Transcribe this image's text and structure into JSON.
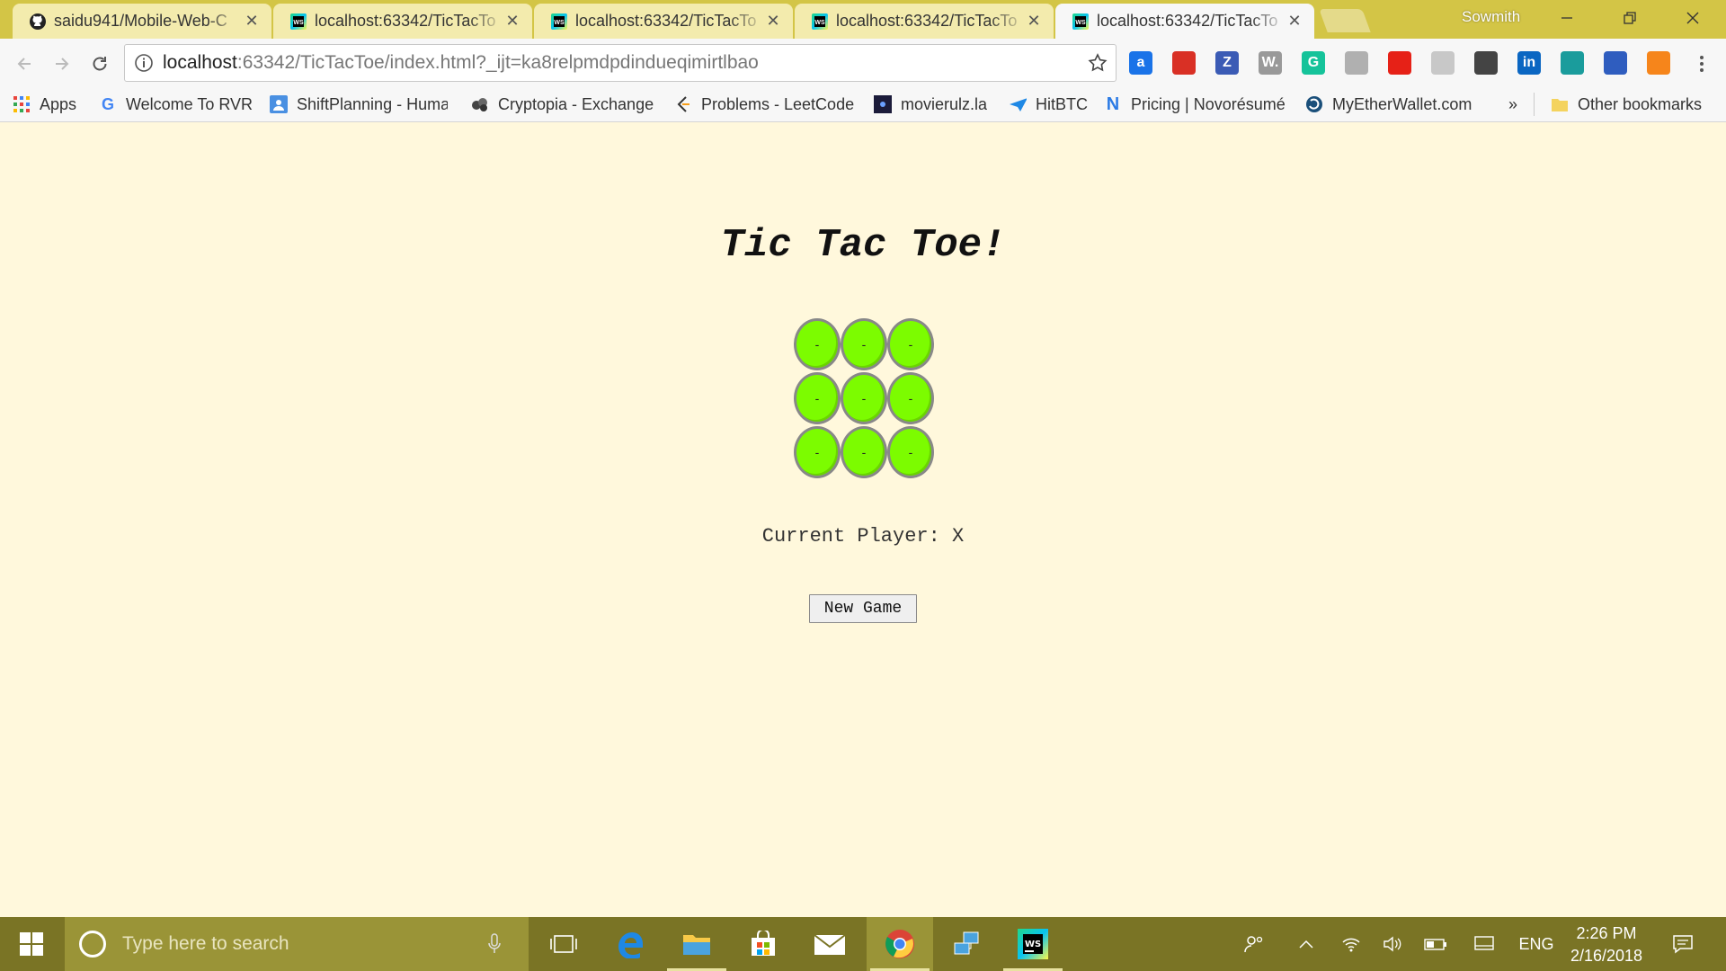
{
  "browser": {
    "tabs": [
      {
        "title": "saidu941/Mobile-Web-C",
        "icon": "github-icon",
        "active": false
      },
      {
        "title": "localhost:63342/TicTacTo",
        "icon": "webstorm-icon",
        "active": false
      },
      {
        "title": "localhost:63342/TicTacTo",
        "icon": "webstorm-icon",
        "active": false
      },
      {
        "title": "localhost:63342/TicTacTo",
        "icon": "webstorm-icon",
        "active": false
      },
      {
        "title": "localhost:63342/TicTacTo",
        "icon": "webstorm-icon",
        "active": true
      }
    ],
    "profile_name": "Sowmith",
    "url_host": "localhost",
    "url_rest": ":63342/TicTacToe/index.html?_ijt=ka8relpmdpdindueqimirtlbao",
    "extensions": [
      {
        "name": "extension-a-icon",
        "glyph": "a",
        "color": "#1a73e8"
      },
      {
        "name": "adblock-icon",
        "glyph": "",
        "color": "#d93025"
      },
      {
        "name": "zotero-icon",
        "glyph": "Z",
        "color": "#3b5bb5"
      },
      {
        "name": "wordpress-w-icon",
        "glyph": "W.",
        "color": "#999999"
      },
      {
        "name": "grammarly-icon",
        "glyph": "G",
        "color": "#15c39a"
      },
      {
        "name": "dropbox-icon",
        "glyph": "",
        "color": "#b0b0b0"
      },
      {
        "name": "youtube-icon",
        "glyph": "",
        "color": "#e62117"
      },
      {
        "name": "pdf-icon",
        "glyph": "",
        "color": "#c8c8c8"
      },
      {
        "name": "evernote-icon",
        "glyph": "",
        "color": "#444444"
      },
      {
        "name": "linkedin-icon",
        "glyph": "in",
        "color": "#0a66c2"
      },
      {
        "name": "refresh-ext-icon",
        "glyph": "",
        "color": "#1a9c9c"
      },
      {
        "name": "ethereum-icon",
        "glyph": "",
        "color": "#2f5dbf"
      },
      {
        "name": "metamask-icon",
        "glyph": "",
        "color": "#f6851b"
      }
    ]
  },
  "bookmarks": {
    "items": [
      {
        "label": "Apps"
      },
      {
        "label": "Welcome To RVR"
      },
      {
        "label": "ShiftPlanning - Huma"
      },
      {
        "label": "Cryptopia - Exchange"
      },
      {
        "label": "Problems - LeetCode"
      },
      {
        "label": "movierulz.la"
      },
      {
        "label": "HitBTC"
      },
      {
        "label": "Pricing | Novorésumé"
      },
      {
        "label": "MyEtherWallet.com"
      }
    ],
    "overflow": "»",
    "other": "Other bookmarks"
  },
  "game": {
    "title": "Tic Tac Toe!",
    "cells": [
      "-",
      "-",
      "-",
      "-",
      "-",
      "-",
      "-",
      "-",
      "-"
    ],
    "status": "Current Player: X",
    "new_game_label": "New Game",
    "cell_color": "#7cfc00",
    "background": "#fff8dc"
  },
  "taskbar": {
    "search_placeholder": "Type here to search",
    "language": "ENG",
    "time": "2:26 PM",
    "date": "2/16/2018"
  }
}
